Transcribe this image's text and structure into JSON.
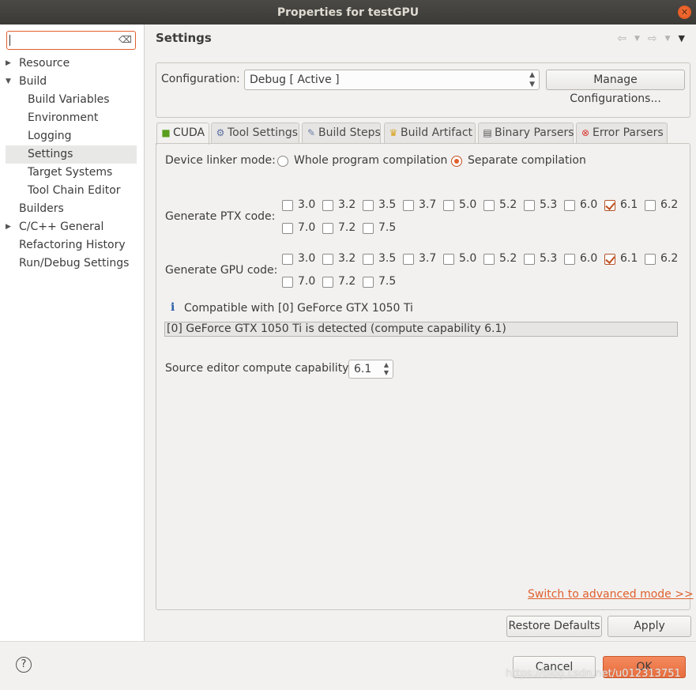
{
  "window": {
    "title": "Properties for testGPU"
  },
  "filter": {
    "value": ""
  },
  "tree": {
    "items": [
      {
        "label": "Resource"
      },
      {
        "label": "Build"
      },
      {
        "label": "Build Variables"
      },
      {
        "label": "Environment"
      },
      {
        "label": "Logging"
      },
      {
        "label": "Settings"
      },
      {
        "label": "Target Systems"
      },
      {
        "label": "Tool Chain Editor"
      },
      {
        "label": "Builders"
      },
      {
        "label": "C/C++ General"
      },
      {
        "label": "Refactoring History"
      },
      {
        "label": "Run/Debug Settings"
      }
    ]
  },
  "page": {
    "title": "Settings"
  },
  "configuration": {
    "label": "Configuration:",
    "value": "Debug  [ Active ]",
    "manage_button": "Manage Configurations..."
  },
  "tabs": [
    {
      "label": "CUDA"
    },
    {
      "label": "Tool Settings"
    },
    {
      "label": "Build Steps"
    },
    {
      "label": "Build Artifact"
    },
    {
      "label": "Binary Parsers"
    },
    {
      "label": "Error Parsers"
    }
  ],
  "cuda": {
    "linker_label": "Device linker mode:",
    "linker_options": [
      "Whole program compilation",
      "Separate compilation"
    ],
    "linker_selected": "Separate compilation",
    "ptx_label": "Generate PTX code:",
    "gpu_label": "Generate GPU code:",
    "versions": [
      "3.0",
      "3.2",
      "3.5",
      "3.7",
      "5.0",
      "5.2",
      "5.3",
      "6.0",
      "6.1",
      "6.2",
      "7.0",
      "7.2",
      "7.5"
    ],
    "ptx_checked": [
      "6.1"
    ],
    "gpu_checked": [
      "6.1"
    ],
    "compatible_text": "Compatible with [0] GeForce GTX 1050 Ti",
    "detected_text": "[0] GeForce GTX 1050 Ti is detected (compute capability 6.1)",
    "source_editor_label": "Source editor compute capability:",
    "source_editor_value": "6.1",
    "advanced_link": "Switch to advanced mode >>"
  },
  "buttons": {
    "restore_defaults": "Restore Defaults",
    "apply": "Apply",
    "cancel": "Cancel",
    "ok": "OK"
  },
  "watermark": "https://blog.csdn.net/u012313751"
}
